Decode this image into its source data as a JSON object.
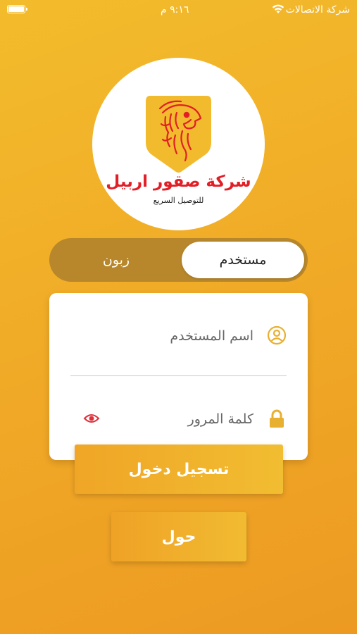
{
  "status_bar": {
    "carrier": "شركة الاتصالات",
    "time": "٩:١٦ م"
  },
  "logo": {
    "company_name": "شركة صقور اربيل",
    "tagline": "للتوصيل السريع"
  },
  "account_type": {
    "options": [
      "مستخدم",
      "زبون"
    ],
    "selected": "مستخدم"
  },
  "form": {
    "username_placeholder": "اسم المستخدم",
    "password_placeholder": "كلمة المرور"
  },
  "buttons": {
    "login_label": "تسجيل دخول",
    "about_label": "حول"
  },
  "colors": {
    "background": "#f0a826",
    "brand_red": "#e21e26",
    "icon_gold": "#e8b030",
    "eye_red": "#e0303a",
    "segment_track": "#b8872b"
  }
}
